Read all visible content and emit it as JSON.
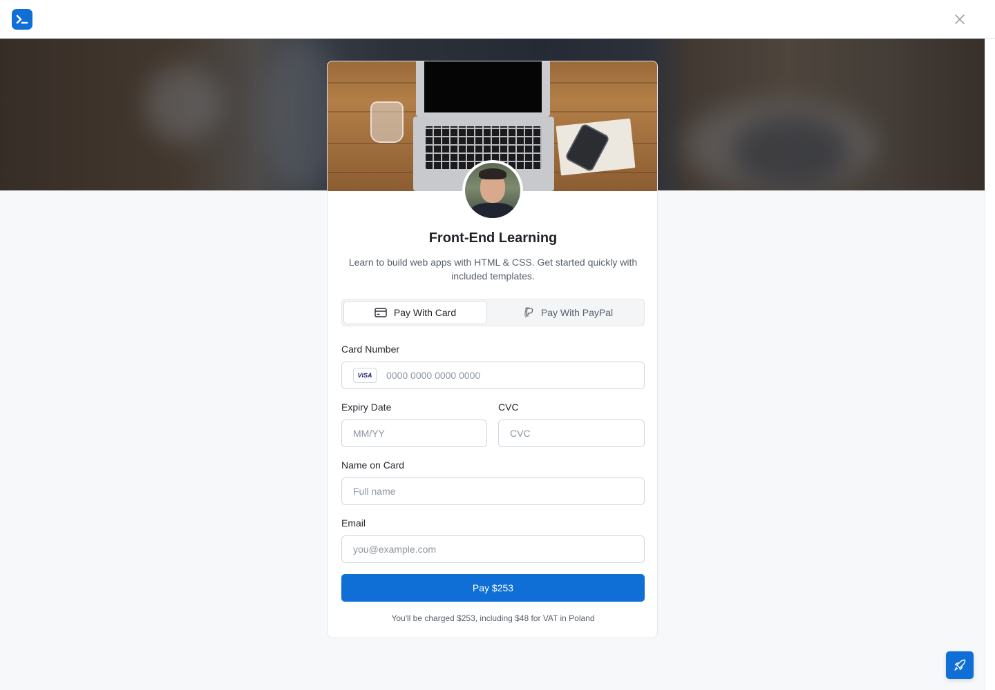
{
  "app": {
    "logo_icon": "terminal-prompt-icon",
    "accent": "#0f6fd6"
  },
  "course": {
    "title": "Front-End Learning",
    "description": "Learn to build web apps with HTML & CSS. Get started quickly with included templates."
  },
  "tabs": [
    {
      "label": "Pay With Card",
      "icon": "credit-card-icon",
      "selected": true
    },
    {
      "label": "Pay With PayPal",
      "icon": "paypal-icon",
      "selected": false
    }
  ],
  "form": {
    "card_number": {
      "label": "Card Number",
      "placeholder": "0000 0000 0000 0000",
      "brand": "VISA"
    },
    "expiry": {
      "label": "Expiry Date",
      "placeholder": "MM/YY"
    },
    "cvc": {
      "label": "CVC",
      "placeholder": "CVC"
    },
    "name": {
      "label": "Name on Card",
      "placeholder": "Full name"
    },
    "email": {
      "label": "Email",
      "placeholder": "you@example.com"
    }
  },
  "pay_button": {
    "label": "Pay $253"
  },
  "footnote": "You'll be charged $253, including $48 for VAT in Poland",
  "fab_icon": "rocket-icon"
}
